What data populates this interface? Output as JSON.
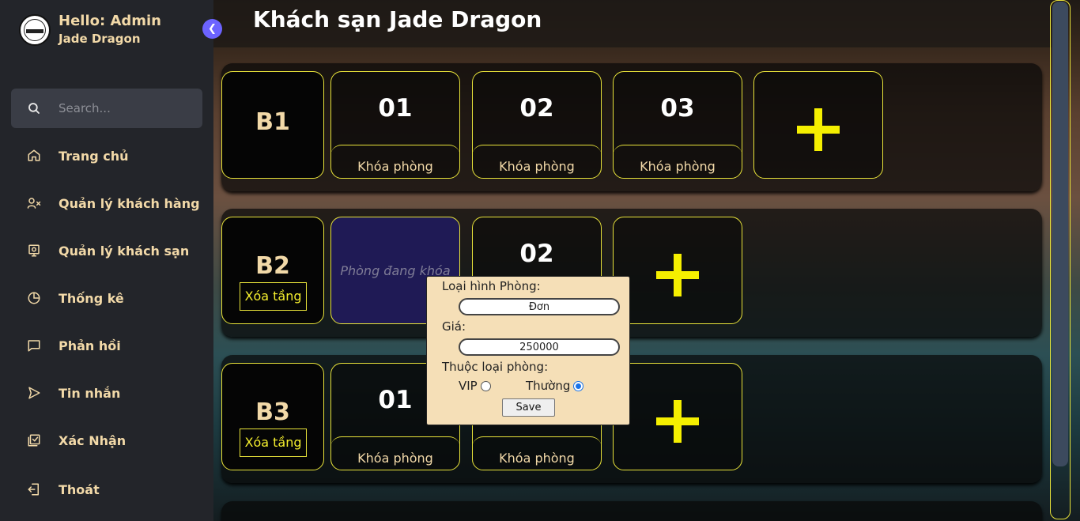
{
  "sidebar": {
    "hello": "Hello: Admin",
    "hotel": "Jade Dragon",
    "search_placeholder": "Search...",
    "items": [
      {
        "label": "Trang chủ",
        "icon": "home-icon"
      },
      {
        "label": "Quản lý khách hàng",
        "icon": "user-x-icon"
      },
      {
        "label": "Quản lý khách sạn",
        "icon": "monitor-icon"
      },
      {
        "label": "Thống kê",
        "icon": "pie-chart-icon"
      },
      {
        "label": "Phản hồi",
        "icon": "message-icon"
      },
      {
        "label": "Tin nhắn",
        "icon": "send-icon"
      },
      {
        "label": "Xác Nhận",
        "icon": "check-square-icon"
      },
      {
        "label": "Thoát",
        "icon": "logout-icon"
      }
    ]
  },
  "main": {
    "title": "Khách sạn Jade Dragon",
    "floors": [
      {
        "name": "B1",
        "delete_label": "",
        "rooms": [
          {
            "number": "01",
            "action": "Khóa phòng"
          },
          {
            "number": "02",
            "action": "Khóa phòng"
          },
          {
            "number": "03",
            "action": "Khóa phòng"
          }
        ]
      },
      {
        "name": "B2",
        "delete_label": "Xóa tầng",
        "locked_text": "Phòng đang khóa",
        "rooms": [
          {
            "number": "02",
            "action": ""
          }
        ]
      },
      {
        "name": "B3",
        "delete_label": "Xóa tầng",
        "rooms": [
          {
            "number": "01",
            "action": "Khóa phòng"
          },
          {
            "number": "",
            "action": "Khóa phòng"
          }
        ]
      }
    ]
  },
  "popup": {
    "room_type_label": "Loại hình Phòng:",
    "room_type_value": "Đơn",
    "price_label": "Giá:",
    "price_value": "250000",
    "category_label": "Thuộc loại phòng:",
    "option_vip": "VIP",
    "option_normal": "Thường",
    "selected_option": "Thường",
    "save_label": "Save"
  },
  "colors": {
    "accent_yellow": "#e8e33a",
    "text_cream": "#f2d9a8",
    "collapse_purple": "#6c63ff",
    "locked_room_bg": "#1f1a55"
  }
}
